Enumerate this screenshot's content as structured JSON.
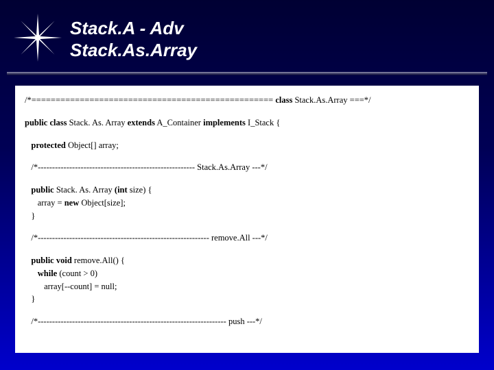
{
  "header": {
    "title_line1": "Stack.A  -  Adv",
    "title_line2": "Stack.As.Array"
  },
  "code": {
    "l1_pre": "/*================================================== ",
    "l1_kw": "class",
    "l1_post": " Stack.As.Array ===*/",
    "l2_kw1": "public class",
    "l2_mid": " Stack. As. Array ",
    "l2_kw2": "extends",
    "l2_mid2": " A_Container ",
    "l2_kw3": "implements",
    "l2_end": " I_Stack {",
    "l3_pre": "   ",
    "l3_kw": "protected",
    "l3_post": " Object[] array;",
    "l4": "   /*------------------------------------------------------- Stack.As.Array ---*/",
    "l5_pre": "   ",
    "l5_kw1": "public",
    "l5_mid": " Stack. As. Array ",
    "l5_kw2": "(int",
    "l5_end": " size) {",
    "l6_pre": "      array = ",
    "l6_kw": "new",
    "l6_post": " Object[size];",
    "l7": "   }",
    "l8": "   /*------------------------------------------------------------ remove.All ---*/",
    "l9_pre": "   ",
    "l9_kw": "public void",
    "l9_post": " remove.All() {",
    "l10_pre": "      ",
    "l10_kw": "while",
    "l10_post": " (count > 0)",
    "l11": "         array[--count] = null;",
    "l12": "   }",
    "l13": "   /*------------------------------------------------------------------ push ---*/"
  }
}
